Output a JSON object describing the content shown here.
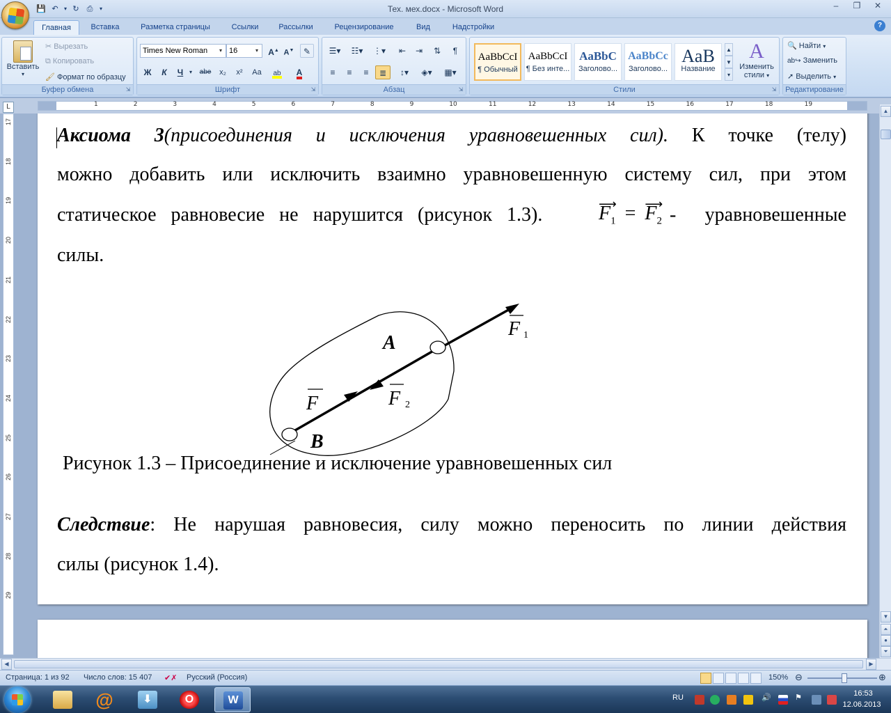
{
  "window": {
    "title": "Тех. мех.docx - Microsoft Word"
  },
  "quick_access": {
    "save_icon": "save-icon",
    "undo_icon": "undo-icon",
    "redo_icon": "redo-icon",
    "print_icon": "print-icon"
  },
  "tabs": [
    "Главная",
    "Вставка",
    "Разметка страницы",
    "Ссылки",
    "Рассылки",
    "Рецензирование",
    "Вид",
    "Надстройки"
  ],
  "active_tab": "Главная",
  "ribbon": {
    "clipboard": {
      "label": "Буфер обмена",
      "paste": "Вставить",
      "cut": "Вырезать",
      "copy": "Копировать",
      "format_painter": "Формат по образцу"
    },
    "font": {
      "label": "Шрифт",
      "font_name": "Times New Roman",
      "font_size": "16",
      "bold": "Ж",
      "italic": "К",
      "underline": "Ч",
      "strike": "abe",
      "subscript": "x₂",
      "superscript": "x²",
      "change_case": "Aa"
    },
    "paragraph": {
      "label": "Абзац"
    },
    "styles": {
      "label": "Стили",
      "items": [
        {
          "sample": "AaBbCcI",
          "name": "¶ Обычный",
          "selected": true
        },
        {
          "sample": "AaBbCcI",
          "name": "¶ Без инте...",
          "selected": false
        },
        {
          "sample": "AaBbC",
          "name": "Заголово...",
          "selected": false
        },
        {
          "sample": "AaBbCc",
          "name": "Заголово...",
          "selected": false
        },
        {
          "sample": "AaB",
          "name": "Название",
          "selected": false
        }
      ],
      "change_styles_line1": "Изменить",
      "change_styles_line2": "стили"
    },
    "editing": {
      "label": "Редактирование",
      "find": "Найти",
      "replace": "Заменить",
      "select": "Выделить"
    }
  },
  "ruler": {
    "h_numbers": [
      "1",
      "2",
      "3",
      "4",
      "5",
      "6",
      "7",
      "8",
      "9",
      "10",
      "11",
      "12",
      "13",
      "14",
      "15",
      "16",
      "17",
      "18",
      "19"
    ],
    "v_numbers": [
      "17",
      "18",
      "19",
      "20",
      "21",
      "22",
      "23",
      "24",
      "25",
      "26",
      "27",
      "28",
      "29"
    ]
  },
  "document": {
    "p1": {
      "axiom": "Аксиома 3",
      "axiom_paren": "(присоединения и исключения уравновешенных сил).",
      "rest1": " К точке (телу)",
      "line2": "можно добавить или исключить взаимно уравновешенную систему сил, при этом",
      "line3_a": "статическое равновесие не нарушится (рисунок 1.3).",
      "eq_F1": "F",
      "eq_sub1": "1",
      "eq_equals": "=",
      "eq_F2": "F",
      "eq_sub2": "2",
      "line3_b": "-",
      "line3_c": "уравновешенные",
      "line4": "силы."
    },
    "figure": {
      "label_A": "A",
      "label_B": "B",
      "label_F": "F",
      "label_F1": "F",
      "label_F1_sub": "1",
      "label_F2": "F",
      "label_F2_sub": "2"
    },
    "caption": "Рисунок 1.3 – Присоединение и исключение уравновешенных сил",
    "p2": {
      "lead": "Следствие",
      "line1_rest": ": Не нарушая равновесия, силу можно переносить по линии действия",
      "line2": "силы (рисунок 1.4)."
    }
  },
  "status_bar": {
    "page": "Страница: 1 из 92",
    "words": "Число слов: 15 407",
    "language": "Русский (Россия)",
    "zoom": "150%"
  },
  "taskbar": {
    "language": "RU",
    "time": "16:53",
    "date": "12.06.2013"
  }
}
